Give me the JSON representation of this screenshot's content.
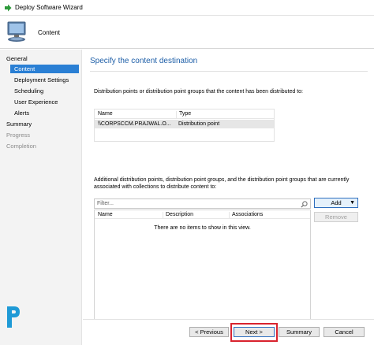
{
  "window": {
    "title": "Deploy Software Wizard",
    "icon": "wizard-arrow-icon"
  },
  "header": {
    "page_label": "Content",
    "icon": "computer-icon"
  },
  "nav": {
    "items": [
      {
        "label": "General",
        "level": "top",
        "state": "normal"
      },
      {
        "label": "Content",
        "level": "sub",
        "state": "active"
      },
      {
        "label": "Deployment Settings",
        "level": "sub",
        "state": "normal"
      },
      {
        "label": "Scheduling",
        "level": "sub",
        "state": "normal"
      },
      {
        "label": "User Experience",
        "level": "sub",
        "state": "normal"
      },
      {
        "label": "Alerts",
        "level": "sub",
        "state": "normal"
      },
      {
        "label": "Summary",
        "level": "top",
        "state": "normal"
      },
      {
        "label": "Progress",
        "level": "top",
        "state": "disabled"
      },
      {
        "label": "Completion",
        "level": "top",
        "state": "disabled"
      }
    ]
  },
  "main": {
    "title": "Specify the content destination",
    "distributed_text": "Distribution points or distribution point groups that the content has been distributed to:",
    "dp_table": {
      "columns": [
        "Name",
        "Type"
      ],
      "rows": [
        {
          "name": "\\\\CORPSCCM.PRAJWAL.O...",
          "type": "Distribution point"
        }
      ]
    },
    "additional_text": "Additional distribution points, distribution point groups, and the distribution point groups that are currently associated with collections to distribute content to:",
    "filter_placeholder": "Filter...",
    "additional_table": {
      "columns": [
        "Name",
        "Description",
        "Associations"
      ],
      "empty_message": "There are no items to show in this view."
    },
    "add_button": "Add",
    "remove_button": "Remove"
  },
  "footer": {
    "previous": "< Previous",
    "next": "Next >",
    "summary": "Summary",
    "cancel": "Cancel"
  },
  "colors": {
    "accent": "#2a7fd4",
    "title_blue": "#1e5fa8",
    "highlight_red": "#d9232e"
  }
}
